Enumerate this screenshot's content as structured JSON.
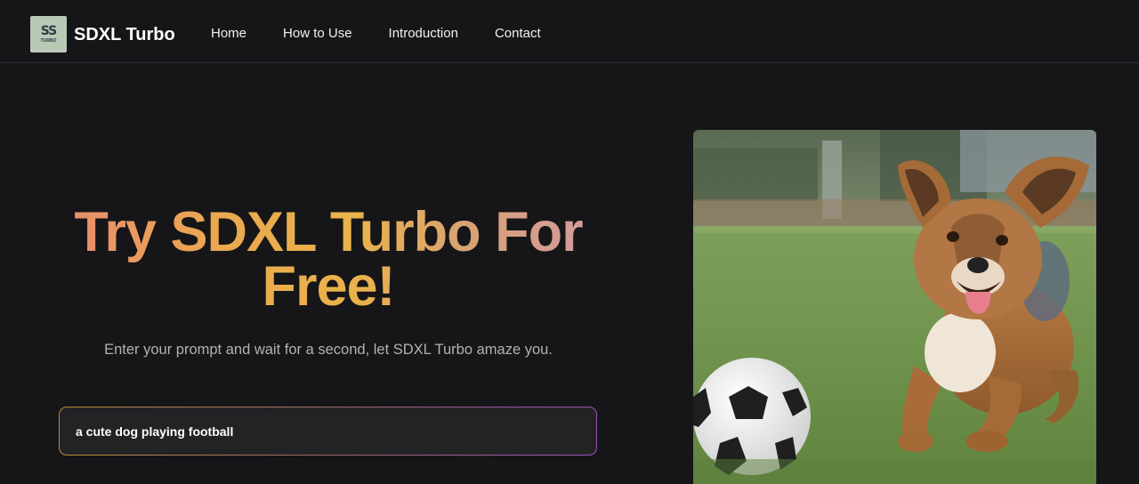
{
  "brand": {
    "name": "SDXL Turbo",
    "logo_mark": "SS",
    "logo_sub": "TURBO"
  },
  "nav": {
    "items": [
      {
        "label": "Home"
      },
      {
        "label": "How to Use"
      },
      {
        "label": "Introduction"
      },
      {
        "label": "Contact"
      }
    ]
  },
  "hero": {
    "title": "Try SDXL Turbo For Free!",
    "subtitle": "Enter your prompt and wait for a second, let SDXL Turbo amaze you."
  },
  "prompt": {
    "value": "a cute dog playing football"
  },
  "colors": {
    "background": "#161618",
    "title_gradient_start": "#e98c6f",
    "title_gradient_mid": "#e9b24c",
    "title_gradient_end": "#d49aa0",
    "input_border_start": "#b68a3a",
    "input_border_end": "#9a4fbf"
  },
  "icons": {
    "logo": "sdxl-turbo-logo-icon"
  }
}
